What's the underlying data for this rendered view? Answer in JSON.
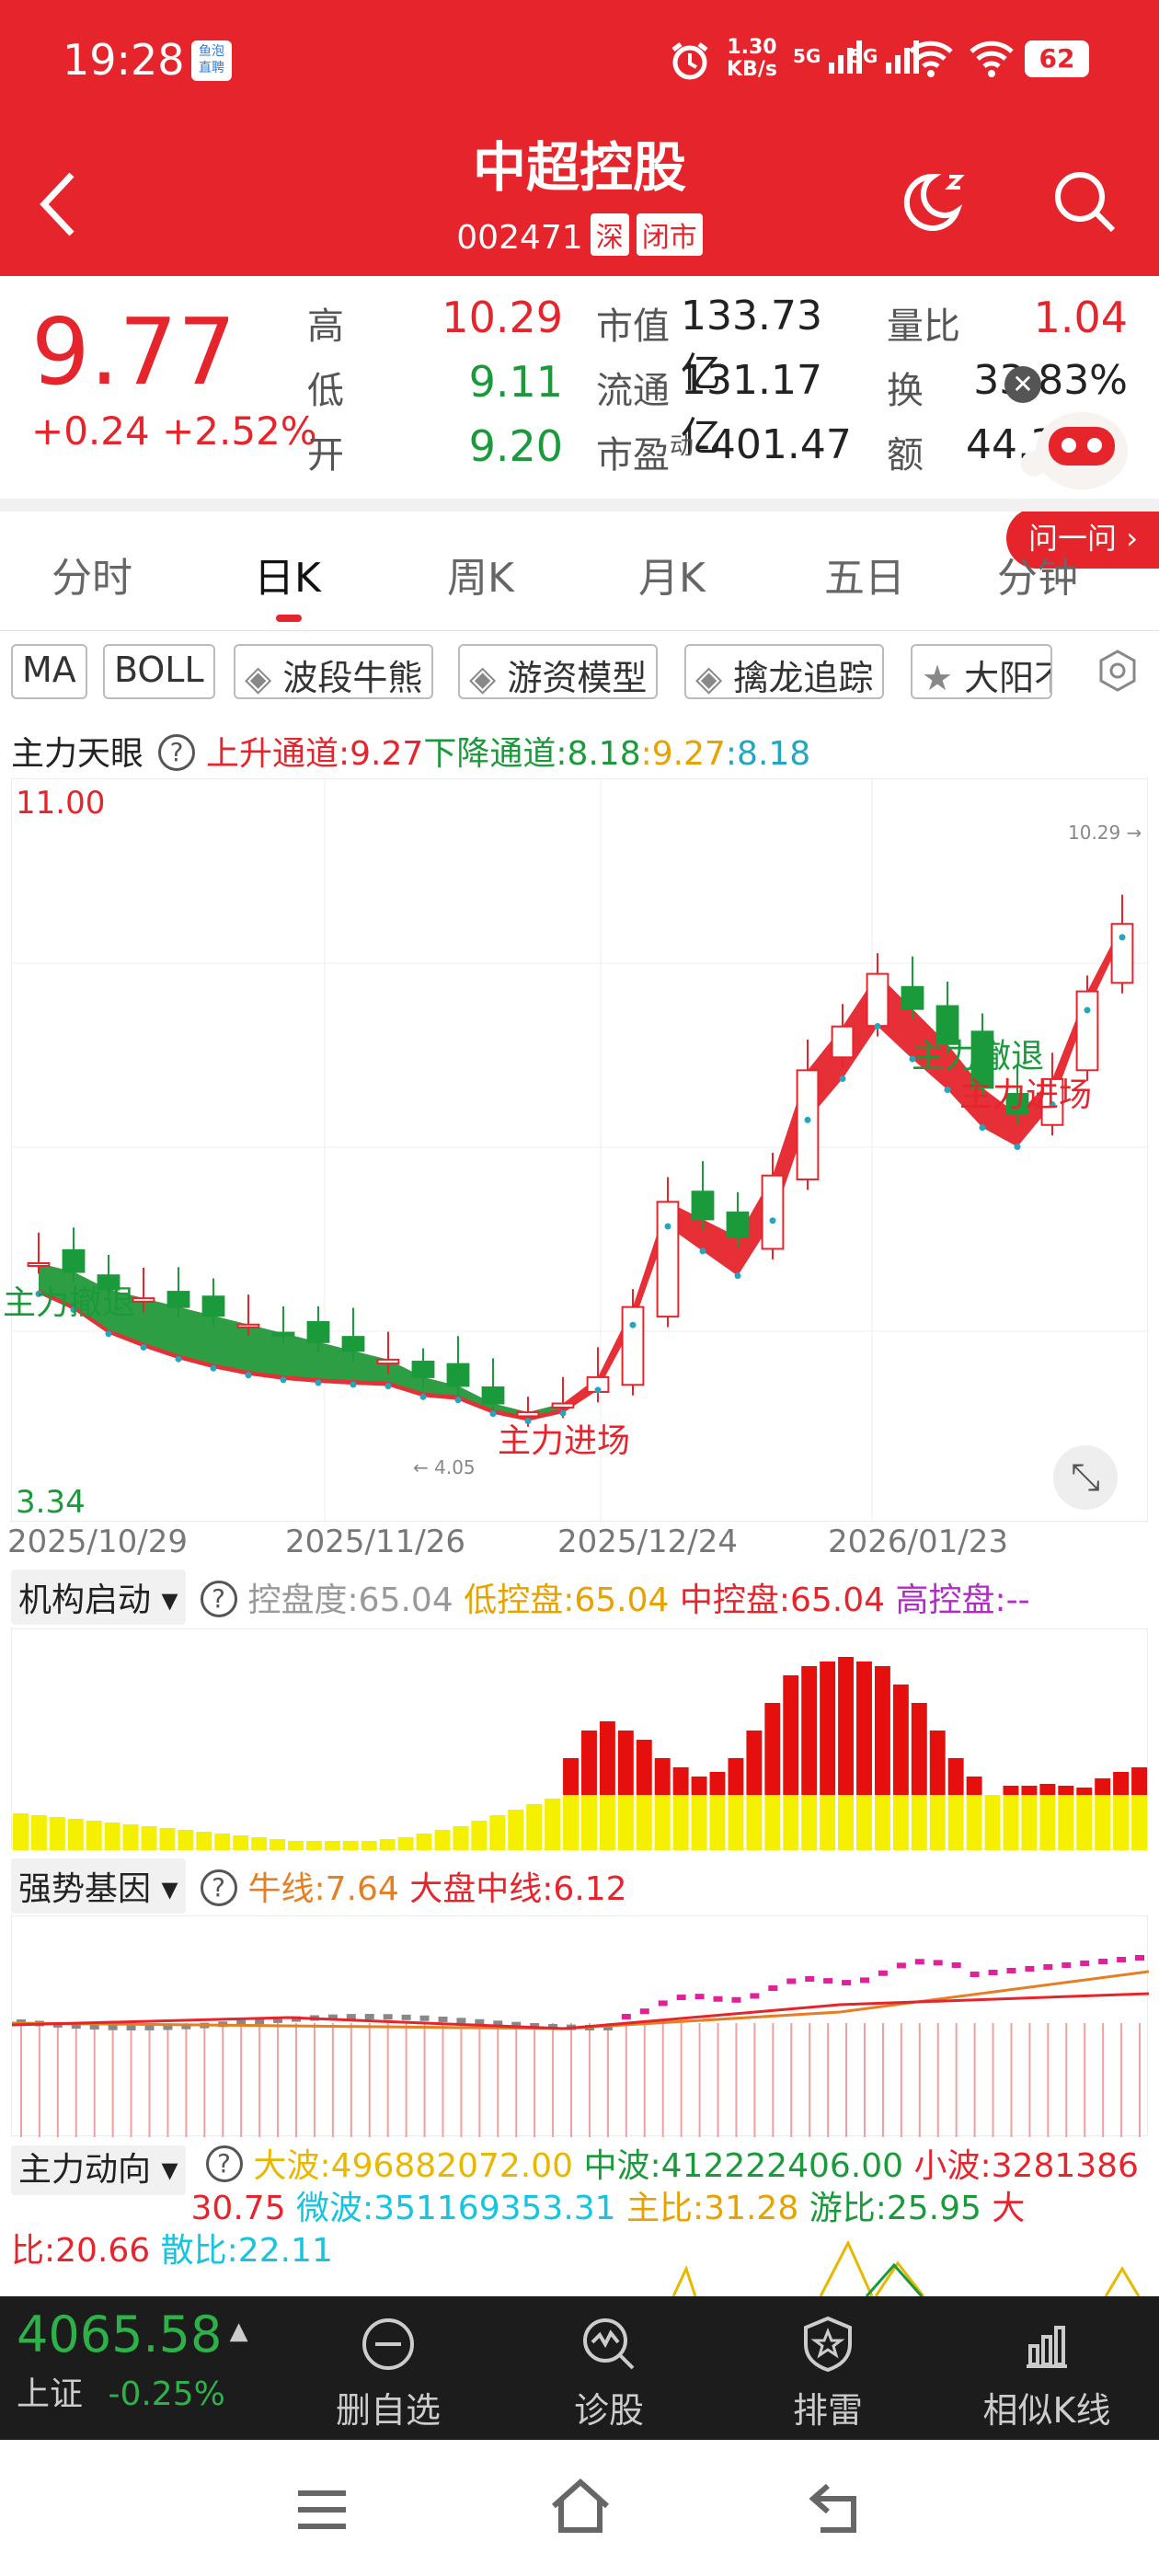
{
  "status": {
    "time": "19:28",
    "badge_line1": "鱼泡",
    "badge_line2": "直聘",
    "net_rate": "1.30",
    "net_unit": "KB/s",
    "sig1": "5G",
    "sig2": "5G",
    "battery": "62"
  },
  "header": {
    "title": "中超控股",
    "code": "002471",
    "tag_market": "深",
    "tag_status": "闭市"
  },
  "quote": {
    "price": "9.77",
    "change": "+0.24",
    "change_pct": "+2.52%",
    "high_label": "高",
    "high": "10.29",
    "low_label": "低",
    "low": "9.11",
    "open_label": "开",
    "open": "9.20",
    "mcap_label": "市值",
    "mcap": "133.73亿",
    "float_label": "流通",
    "float": "131.17亿",
    "pe_label": "市盈",
    "pe_sup": "动",
    "pe": "-401.47",
    "vr_label": "量比",
    "vr": "1.04",
    "turn_label": "换",
    "turn": "33.83%",
    "amt_label": "额",
    "amt": "44.3…"
  },
  "ask_button": "问一问",
  "tabs": [
    "分时",
    "日K",
    "周K",
    "月K",
    "五日",
    "分钟"
  ],
  "active_tab": "日K",
  "chips": [
    "MA",
    "BOLL",
    "波段牛熊",
    "游资模型",
    "擒龙追踪",
    "大阳不"
  ],
  "main_indicator": {
    "name": "主力天眼",
    "up_channel": "上升通道:9.27",
    "down_channel": "下降通道:8.18",
    "v3": ":9.27",
    "v4": ":8.18"
  },
  "chart": {
    "ymax": "11.00",
    "ymin": "3.34",
    "high_mark": "10.29",
    "low_mark": "4.05",
    "dates": [
      "2025/10/29",
      "2025/11/26",
      "2025/12/24",
      "2026/01/23"
    ],
    "signal1": "主力撤退",
    "signal2": "主力进场",
    "signal3": "主力撤退",
    "signal4": "主力进场"
  },
  "ind2": {
    "name": "机构启动",
    "a": "控盘度:65.04",
    "b": "低控盘:65.04",
    "c": "中控盘:65.04",
    "d": "高控盘:--"
  },
  "ind3": {
    "name": "强势基因",
    "a": "牛线:7.64",
    "b": "大盘中线:6.12"
  },
  "ind4": {
    "name": "主力动向",
    "a": "大波:496882072.00",
    "b": "中波:412222406.00",
    "c": "小波:328138630.75",
    "d": "微波:351169353.31",
    "e": "主比:31.28",
    "f": "游比:25.95",
    "g": "大比:20.66",
    "h": "散比:22.11"
  },
  "index": {
    "value": "4065.58",
    "name": "上证",
    "pct": "-0.25%"
  },
  "nav": [
    "删自选",
    "诊股",
    "排雷",
    "相似K线"
  ],
  "colors": {
    "brand": "#e5242c",
    "up": "#e5242c",
    "down": "#1a9a3a"
  },
  "chart_data": {
    "type": "candlestick",
    "ylim": [
      3.34,
      11.0
    ],
    "x_ticks": [
      "2025/10/29",
      "2025/11/26",
      "2025/12/24",
      "2026/01/23"
    ],
    "close_approx": [
      5.9,
      5.8,
      5.6,
      5.5,
      5.4,
      5.3,
      5.2,
      5.1,
      5.0,
      4.9,
      4.8,
      4.6,
      4.5,
      4.3,
      4.2,
      4.3,
      4.6,
      5.4,
      6.6,
      6.4,
      6.2,
      6.9,
      8.1,
      8.6,
      9.2,
      8.8,
      8.4,
      7.9,
      7.6,
      8.0,
      9.0,
      9.77
    ]
  }
}
